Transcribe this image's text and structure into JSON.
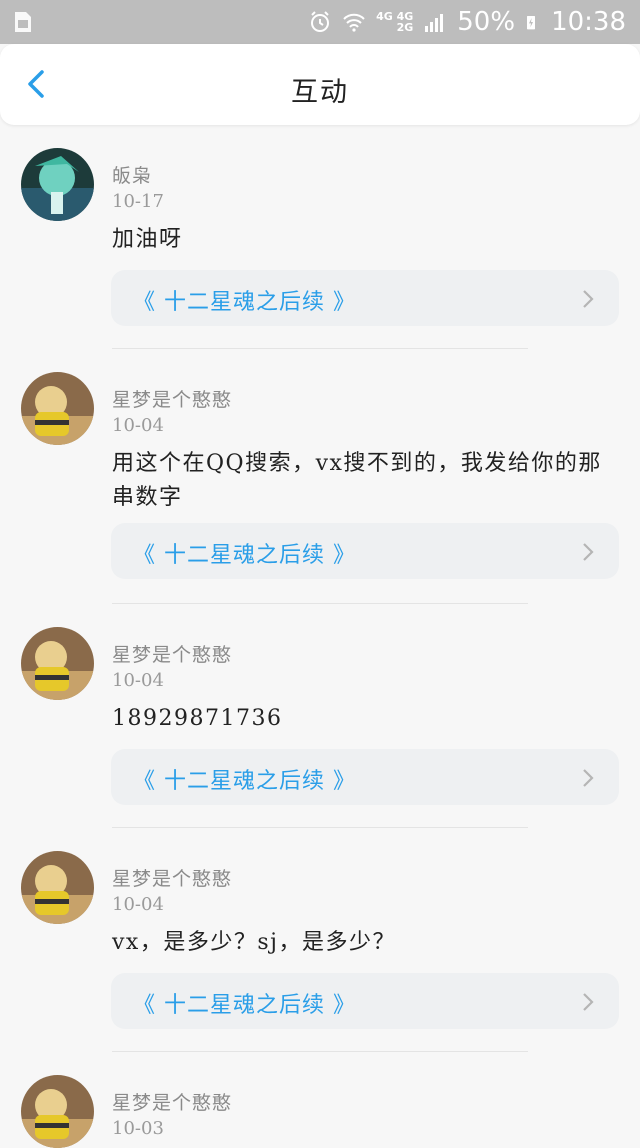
{
  "status_bar": {
    "network_top": "4G 4G",
    "network_bottom": "2G",
    "battery": "50%",
    "time": "10:38",
    "icons": [
      "sim-icon",
      "alarm-icon",
      "wifi-icon",
      "signal-icon",
      "battery-charging-icon"
    ]
  },
  "header": {
    "title": "互动",
    "back_icon": "chevron-left-icon",
    "accent_color": "#2a9ee8"
  },
  "items": [
    {
      "author": "皈枭",
      "date": "10-17",
      "content": "加油呀",
      "ref": "《 十二星魂之后续 》"
    },
    {
      "author": "星梦是个憨憨",
      "date": "10-04",
      "content": "用这个在QQ搜索，vx搜不到的，我发给你的那串数字",
      "ref": "《 十二星魂之后续 》"
    },
    {
      "author": "星梦是个憨憨",
      "date": "10-04",
      "content": "18929871736",
      "ref": "《 十二星魂之后续 》"
    },
    {
      "author": "星梦是个憨憨",
      "date": "10-04",
      "content": "vx，是多少？sj，是多少？",
      "ref": "《 十二星魂之后续 》"
    },
    {
      "author": "星梦是个憨憨",
      "date": "10-03"
    }
  ]
}
